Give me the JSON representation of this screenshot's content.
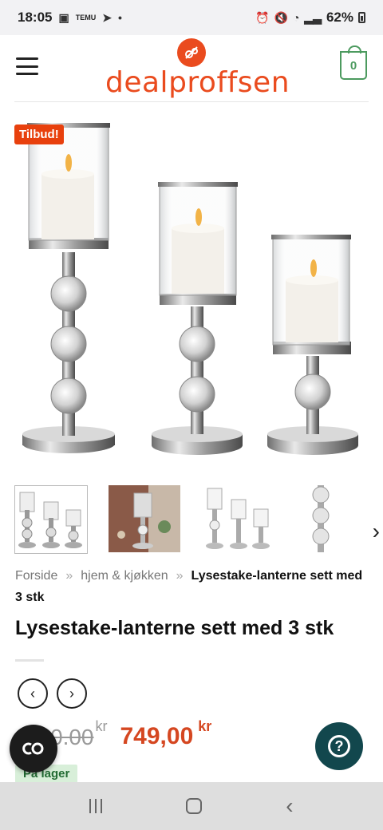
{
  "status_bar": {
    "time": "18:05",
    "notif_text": "TEMU",
    "battery": "62%"
  },
  "header": {
    "brand": "dealproffsen",
    "cart_count": "0",
    "brand_color": "#ea4b1e"
  },
  "product_image": {
    "badge": "Tilbud!",
    "thumbnails_count": 4
  },
  "breadcrumb": {
    "home": "Forside",
    "separator": "»",
    "category": "hjem & kjøkken",
    "current": "Lysestake-lanterne sett med 3 stk"
  },
  "product": {
    "title": "Lysestake-lanterne sett med 3 stk",
    "old_price": "0.00",
    "old_currency": "kr",
    "price": "749,00",
    "currency": "kr",
    "stock": "På lager"
  },
  "icons": {
    "prev": "chevron-left-icon",
    "next": "chevron-right-icon",
    "help": "question-icon",
    "left_float": "co-logo-icon"
  }
}
